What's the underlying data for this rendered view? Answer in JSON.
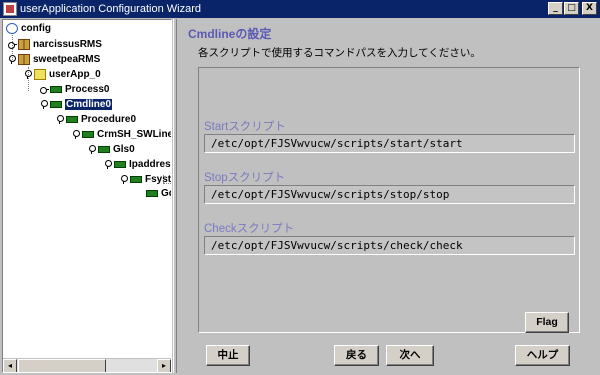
{
  "window": {
    "title": "userApplication Configuration Wizard",
    "minimize": "_",
    "maximize": "□",
    "close": "X"
  },
  "tree": {
    "nodes": [
      {
        "label": "config"
      },
      {
        "label": "narcissusRMS"
      },
      {
        "label": "sweetpeaRMS"
      },
      {
        "label": "userApp_0"
      },
      {
        "label": "Process0"
      },
      {
        "label": "Cmdline0"
      },
      {
        "label": "Procedure0"
      },
      {
        "label": "CrmSH_SWLine"
      },
      {
        "label": "Gls0"
      },
      {
        "label": "Ipaddress"
      },
      {
        "label": "Fsyste"
      },
      {
        "label": "Gd"
      }
    ],
    "scroll_left": "◂",
    "scroll_right": "▸"
  },
  "main": {
    "heading": "Cmdlineの設定",
    "instruction": "各スクリプトで使用するコマンドパスを入力してください。",
    "start_label": "Startスクリプト",
    "start_value": "/etc/opt/FJSVwvucw/scripts/start/start",
    "stop_label": "Stopスクリプト",
    "stop_value": "/etc/opt/FJSVwvucw/scripts/stop/stop",
    "check_label": "Checkスクリプト",
    "check_value": "/etc/opt/FJSVwvucw/scripts/check/check",
    "flag_button": "Flag"
  },
  "footer": {
    "cancel": "中止",
    "back": "戻る",
    "next": "次へ",
    "help": "ヘルプ"
  }
}
